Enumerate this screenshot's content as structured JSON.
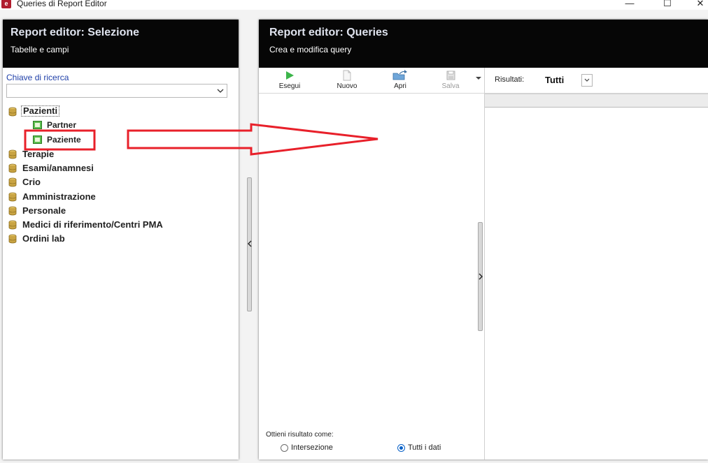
{
  "window": {
    "title": "Queries di Report Editor",
    "app_icon_glyph": "e",
    "controls": {
      "minimize": "—",
      "maximize": "☐",
      "close": "✕"
    }
  },
  "left_panel": {
    "title": "Report editor: Selezione",
    "subtitle": "Tabelle e campi",
    "search_label": "Chiave di ricerca",
    "search_value": "",
    "tree": {
      "root": {
        "label": "Pazienti",
        "children": [
          {
            "label": "Partner"
          },
          {
            "label": "Paziente"
          }
        ]
      },
      "others": [
        {
          "label": "Terapie"
        },
        {
          "label": "Esami/anamnesi"
        },
        {
          "label": "Crio"
        },
        {
          "label": "Amministrazione"
        },
        {
          "label": "Personale"
        },
        {
          "label": "Medici di riferimento/Centri PMA"
        },
        {
          "label": "Ordini lab"
        }
      ]
    }
  },
  "right_panel": {
    "title": "Report editor: Queries",
    "subtitle": "Crea e modifica query",
    "toolbar": {
      "run_label": "Esegui",
      "new_label": "Nuovo",
      "open_label": "Apri",
      "save_label": "Salva"
    },
    "results": {
      "label": "Risultati:",
      "value": "Tutti"
    },
    "bottom": {
      "label": "Ottieni risultato come:",
      "options": [
        {
          "label": "Intersezione",
          "checked": false
        },
        {
          "label": "Tutti i dati",
          "checked": true
        }
      ]
    }
  },
  "colors": {
    "header_bg": "#060606",
    "accent_blue": "#0a62c8",
    "annotation_red": "#e8202a",
    "db_icon": "#c9a443",
    "table_icon": "#5cbe4f"
  },
  "icons": [
    "database-icon",
    "table-icon",
    "play-icon",
    "document-icon",
    "folder-open-icon",
    "save-icon",
    "chevron-down-icon"
  ]
}
